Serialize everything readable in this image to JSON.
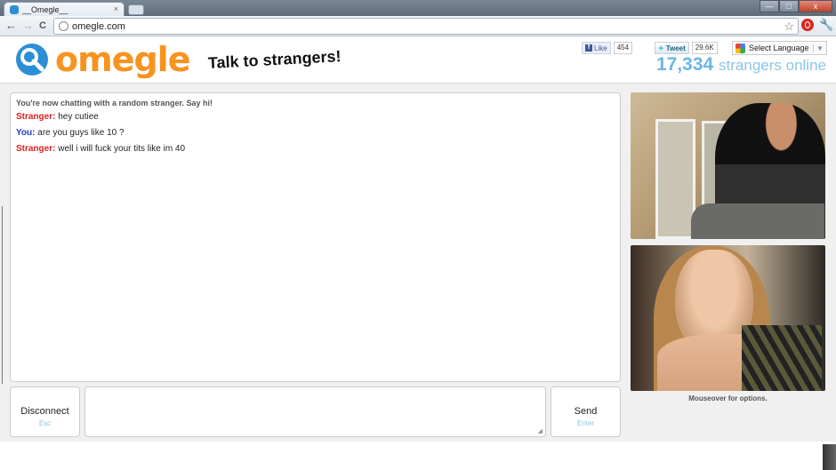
{
  "browser": {
    "tab_title": "__Omegle__",
    "tab_close": "×",
    "url": "omegle.com",
    "star": "☆",
    "back": "←",
    "forward": "→",
    "reload": "C",
    "wrench": "🔧",
    "window_buttons": [
      "—",
      "□",
      "x"
    ]
  },
  "header": {
    "logo_text": "omegle",
    "tagline": "Talk to strangers!",
    "fb_like_label": "Like",
    "fb_like_count": "454",
    "tweet_label": "Tweet",
    "tweet_count": "29.6K",
    "language_label": "Select Language",
    "language_arrow": "▼",
    "online_count": "17,334",
    "online_label": "strangers online"
  },
  "chat": {
    "status": "You're now chatting with a random stranger. Say hi!",
    "messages": [
      {
        "who": "Stranger:",
        "text": "hey cutiee"
      },
      {
        "who": "You:",
        "text": "are you guys like 10 ?"
      },
      {
        "who": "Stranger:",
        "text": "well i will fuck your tits like im 40"
      }
    ]
  },
  "video": {
    "caption": "Mouseover for options."
  },
  "controls": {
    "disconnect_label": "Disconnect",
    "disconnect_hint": "Esc",
    "send_label": "Send",
    "send_hint": "Enter",
    "input_value": ""
  },
  "colors": {
    "logo_orange": "#f7931e",
    "logo_blue": "#2c8fd6",
    "stranger_red": "#e02020",
    "you_blue": "#1f3cc9",
    "online_blue": "#6ab6e6"
  }
}
